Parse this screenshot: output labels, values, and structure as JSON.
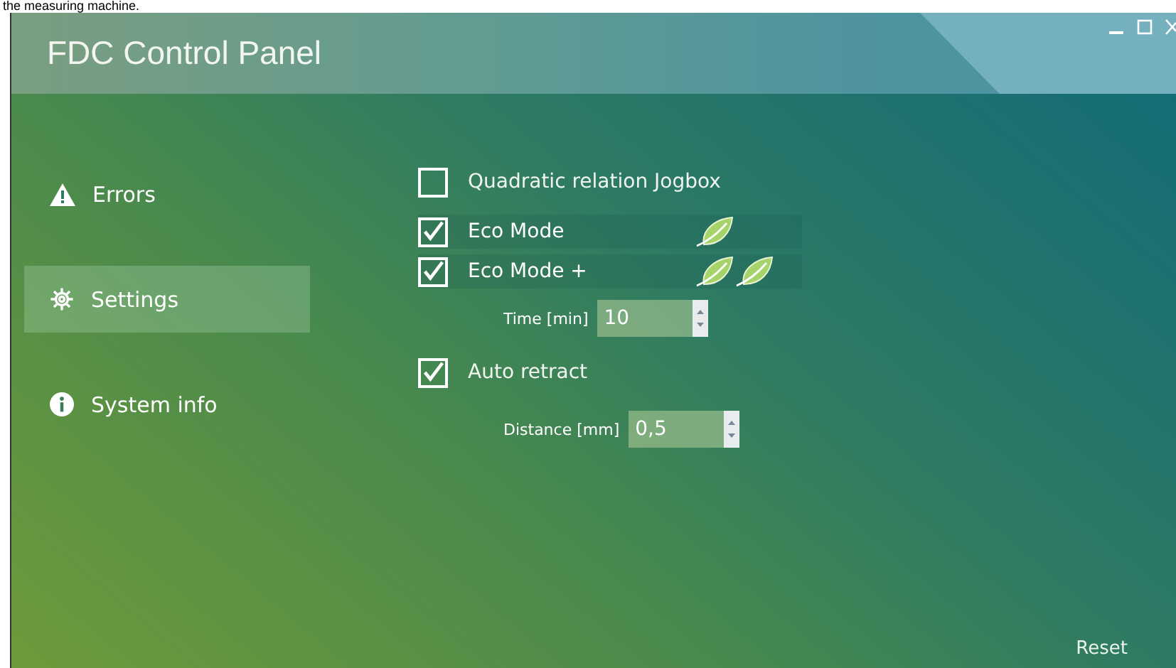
{
  "caption": "the measuring machine.",
  "window": {
    "title": "FDC Control Panel"
  },
  "sidebar": {
    "items": [
      {
        "kind": "warning",
        "label": "Errors",
        "selected": false
      },
      {
        "kind": "gear",
        "label": "Settings",
        "selected": true
      },
      {
        "kind": "info",
        "label": "System info",
        "selected": false
      }
    ]
  },
  "settings": [
    {
      "kind": "checkbox",
      "label": "Quadratic relation Jogbox",
      "checked": false
    },
    {
      "kind": "eco",
      "label": "Eco Mode",
      "checked": true
    },
    {
      "kind": "ecoplus",
      "label": "Eco Mode +",
      "checked": true
    },
    {
      "kind": "spinner",
      "label": "Time [min]",
      "value": "10"
    },
    {
      "kind": "checkbox",
      "label": "Auto retract",
      "checked": true
    },
    {
      "kind": "spinner",
      "label": "Distance [mm]",
      "value": "0,5"
    }
  ],
  "reset_button": "Reset"
}
